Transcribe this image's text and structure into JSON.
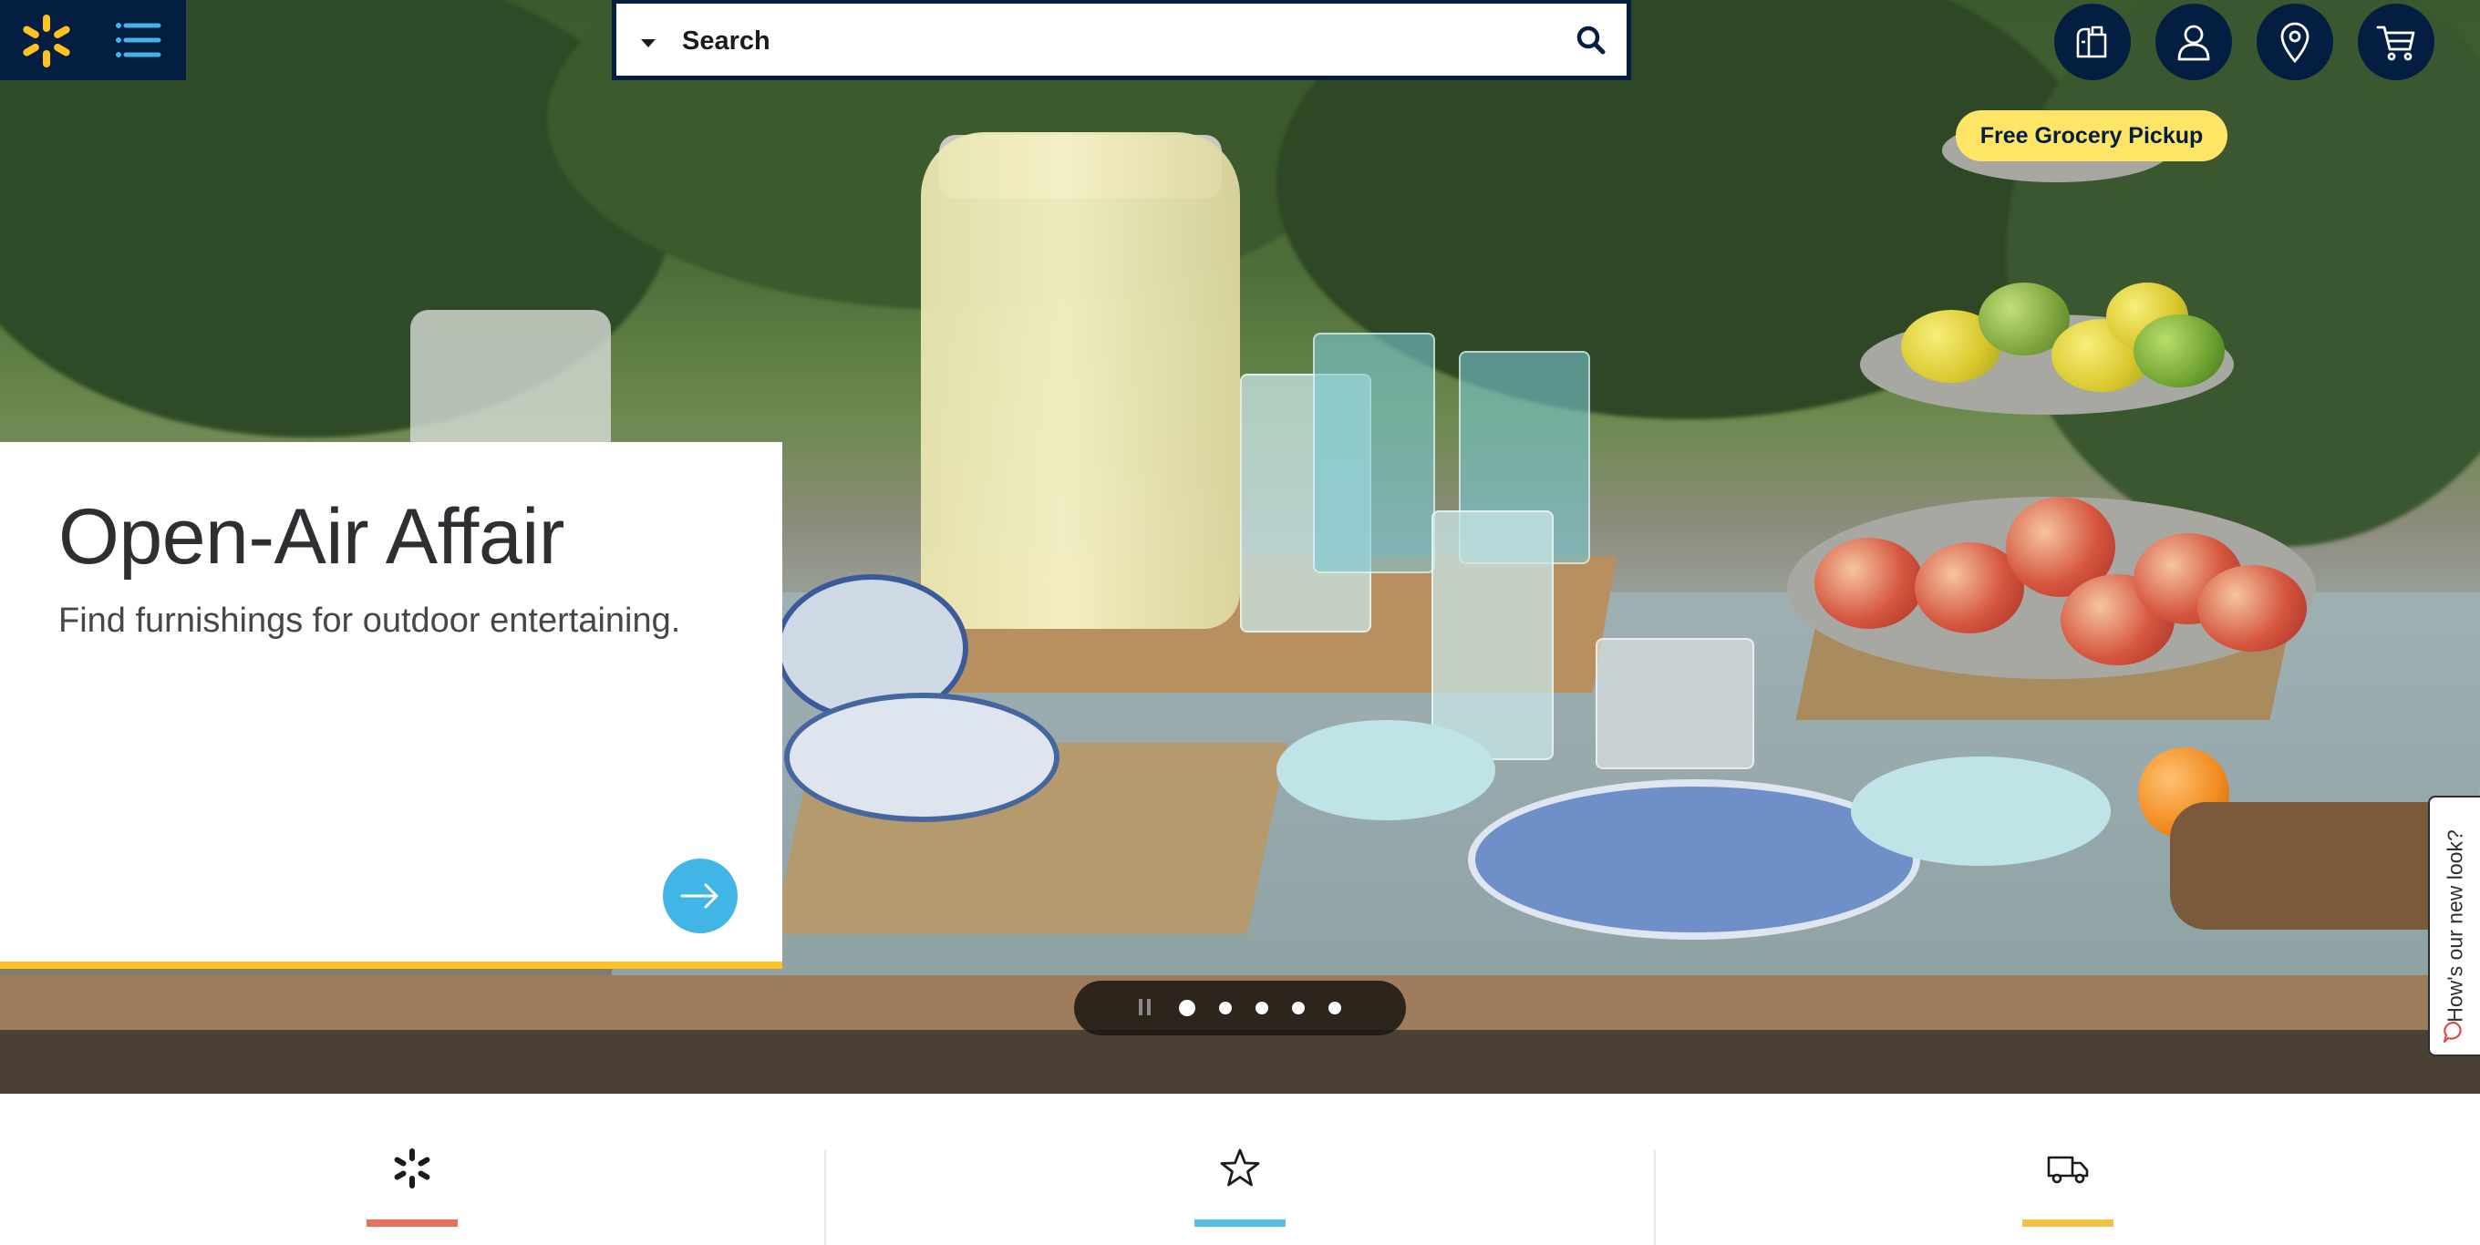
{
  "header": {
    "brand": "Walmart",
    "menu_icon": "hamburger-menu-icon",
    "brand_color": "#041e42",
    "accent_yellow": "#ffc220"
  },
  "search": {
    "placeholder": "Search",
    "department_icon": "caret-down-icon",
    "submit_icon": "search-icon"
  },
  "header_actions": [
    {
      "name": "grocery",
      "icon": "grocery-icon"
    },
    {
      "name": "account",
      "icon": "user-icon"
    },
    {
      "name": "store-finder",
      "icon": "location-pin-icon"
    },
    {
      "name": "cart",
      "icon": "cart-icon"
    }
  ],
  "pickup_badge": "Free Grocery Pickup",
  "hero": {
    "title": "Open-Air Affair",
    "subtitle": "Find furnishings for outdoor entertaining.",
    "cta_icon": "arrow-right-icon"
  },
  "carousel": {
    "slide_count": 5,
    "active_index": 0,
    "pause_icon": "pause-icon"
  },
  "feedback": {
    "label": "How's our new look?",
    "icon": "speech-bubble-icon"
  },
  "features": [
    {
      "icon": "spark-icon",
      "color": "#e8705f"
    },
    {
      "icon": "star-icon",
      "color": "#58bfe3"
    },
    {
      "icon": "truck-icon",
      "color": "#f2c242"
    }
  ]
}
